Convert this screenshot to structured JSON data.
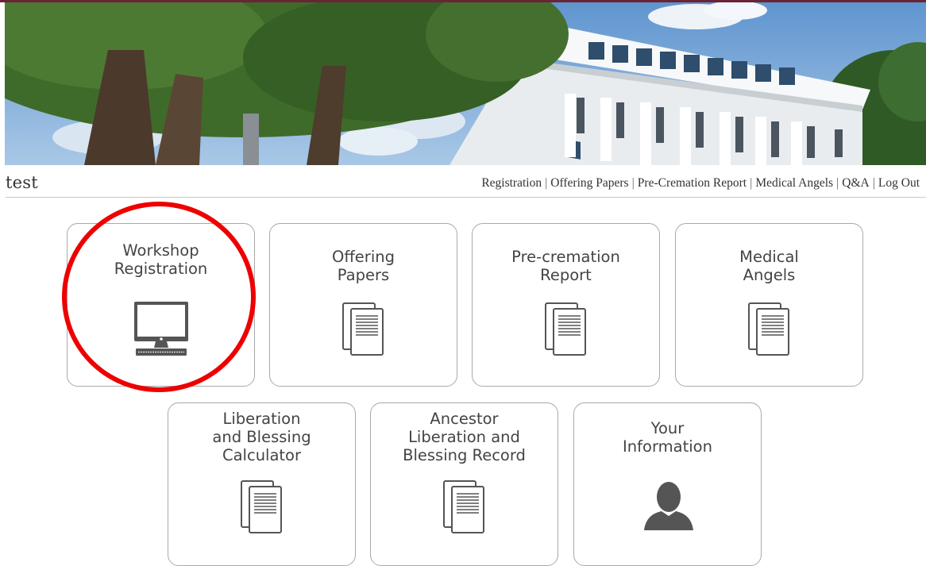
{
  "header": {
    "site_name": "test",
    "nav": [
      "Registration",
      "Offering Papers",
      "Pre-Cremation Report",
      "Medical Angels",
      "Q&A",
      "Log Out"
    ]
  },
  "tiles": [
    {
      "lines": [
        "Workshop",
        "Registration"
      ],
      "icon": "desktop-computer-icon",
      "highlighted": true
    },
    {
      "lines": [
        "Offering",
        "Papers"
      ],
      "icon": "documents-icon"
    },
    {
      "lines": [
        "Pre-cremation",
        "Report"
      ],
      "icon": "documents-icon"
    },
    {
      "lines": [
        "Medical",
        "Angels"
      ],
      "icon": "documents-icon"
    },
    {
      "lines": [
        "Liberation",
        "and Blessing",
        "Calculator"
      ],
      "icon": "documents-icon"
    },
    {
      "lines": [
        "Ancestor",
        "Liberation and",
        "Blessing Record"
      ],
      "icon": "documents-icon"
    },
    {
      "lines": [
        "Your",
        "Information"
      ],
      "icon": "user-silhouette-icon"
    }
  ],
  "colors": {
    "accent_bar": "#6a2436",
    "highlight_circle": "#ee0000",
    "tile_border": "#a9a9a9",
    "icon": "#555555"
  }
}
